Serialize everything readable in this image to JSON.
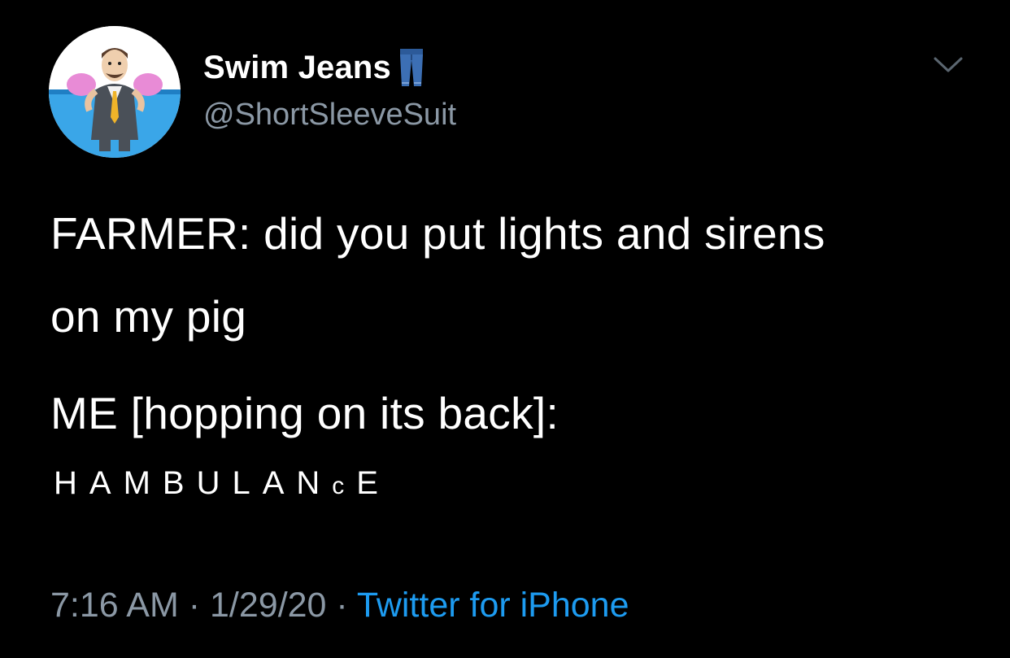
{
  "tweet": {
    "display_name": "Swim Jeans",
    "name_emoji": "jeans-icon",
    "handle": "@ShortSleeveSuit",
    "menu_icon": "chevron-down-icon",
    "avatar_icon": "cartoon-swimmer-avatar",
    "body": {
      "line1": "FARMER: did you put lights and sirens",
      "line2": "on my pig",
      "line3": "ME [hopping on its back]:",
      "spaced_part1": "HAMBULAN",
      "spaced_small": "c",
      "spaced_part2": "E"
    },
    "meta": {
      "time": "7:16 AM",
      "sep1": "·",
      "date": "1/29/20",
      "sep2": "·",
      "source": "Twitter for iPhone"
    }
  },
  "colors": {
    "background": "#000000",
    "text": "#ffffff",
    "secondary": "#8b98a5",
    "link": "#1d9bf0"
  }
}
